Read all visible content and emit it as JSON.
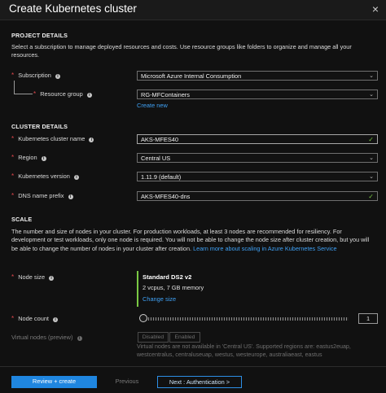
{
  "window": {
    "title": "Create Kubernetes cluster",
    "close_glyph": "×"
  },
  "project": {
    "heading": "PROJECT DETAILS",
    "description": "Select a subscription to manage deployed resources and costs. Use resource groups like folders to organize and manage all your resources.",
    "subscription_label": "Subscription",
    "subscription_value": "Microsoft Azure Internal Consumption",
    "resource_group_label": "Resource group",
    "resource_group_value": "RG-MFContainers",
    "create_new": "Create new"
  },
  "cluster": {
    "heading": "CLUSTER DETAILS",
    "name_label": "Kubernetes cluster name",
    "name_value": "AKS-MFES40",
    "region_label": "Region",
    "region_value": "Central US",
    "version_label": "Kubernetes version",
    "version_value": "1.11.9 (default)",
    "dns_label": "DNS name prefix",
    "dns_value": "AKS-MFES40-dns"
  },
  "scale": {
    "heading": "SCALE",
    "description": "The number and size of nodes in your cluster. For production workloads, at least 3 nodes are recommended for resiliency. For development or test workloads, only one node is required. You will not be able to change the node size after cluster creation, but you will be able to change the number of nodes in your cluster after creation.",
    "learn_more": "Learn more about scaling in Azure Kubernetes Service",
    "node_size_label": "Node size",
    "node_size_name": "Standard DS2 v2",
    "node_size_spec": "2 vcpus, 7 GB memory",
    "change_size": "Change size",
    "node_count_label": "Node count",
    "node_count_value": "1",
    "node_count_fraction": 0.0,
    "virtual_nodes_label": "Virtual nodes (preview)",
    "toggle_disabled": "Disabled",
    "toggle_enabled": "Enabled",
    "virtual_nodes_note": "Virtual nodes are not available in 'Central US'. Supported regions are: eastus2euap, westcentralus, centraluseuap, westus, westeurope, australiaeast, eastus"
  },
  "footer": {
    "review_create": "Review + create",
    "previous": "Previous",
    "next": "Next : Authentication >"
  },
  "icons": {
    "info": "i",
    "chevron": "⌄",
    "check": "✓",
    "required": "*"
  },
  "colors": {
    "accent": "#1f86e0",
    "link": "#3fa1f5",
    "valid": "#7ac943",
    "required": "#e0474c"
  }
}
